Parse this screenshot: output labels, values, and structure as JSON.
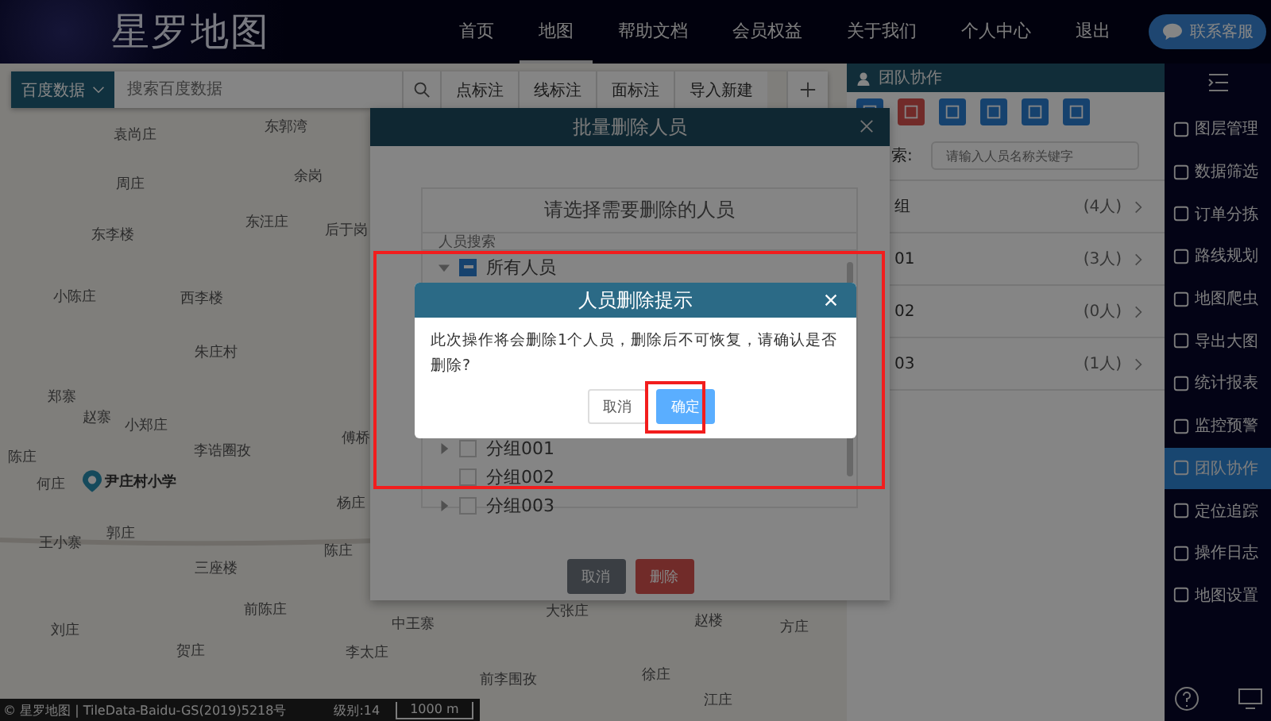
{
  "header": {
    "logo": "星罗地图",
    "nav": [
      {
        "label": "首页",
        "selected": false
      },
      {
        "label": "地图",
        "selected": true
      },
      {
        "label": "帮助文档",
        "selected": false
      },
      {
        "label": "会员权益",
        "selected": false
      },
      {
        "label": "关于我们",
        "selected": false
      },
      {
        "label": "个人中心",
        "selected": false
      },
      {
        "label": "退出",
        "selected": false
      }
    ],
    "contact_button": "联系客服"
  },
  "toolbar": {
    "source": "百度数据",
    "search": {
      "placeholder": "搜索百度数据"
    },
    "tools": [
      "点标注",
      "线标注",
      "面标注",
      "导入新建"
    ]
  },
  "map": {
    "labels": [
      "袁尚庄",
      "东郭湾",
      "周庄",
      "余岗",
      "东汪庄",
      "后于岗",
      "东李楼",
      "小陈庄",
      "西李楼",
      "朱庄村",
      "郑寨",
      "赵寨",
      "小郑庄",
      "李诰圈孜",
      "傅桥",
      "陈庄",
      "何庄",
      "杨庄",
      "郭庄",
      "王小寨",
      "陈庄",
      "三座楼",
      "前陈庄",
      "刘庄",
      "贺庄",
      "大张庄",
      "中王寨",
      "李太庄",
      "赵楼",
      "方庄",
      "徐庄",
      "前李围孜",
      "江庄"
    ],
    "poi": "尹庄村小学"
  },
  "status_bar": {
    "attribution": "© 星罗地图 | TileData-Baidu-GS(2019)5218号",
    "zoom_level": "级别:14",
    "scale": "1000 m"
  },
  "team_panel": {
    "title": "团队协作",
    "search_label": "索:",
    "search": {
      "placeholder": "请输入人员名称关键字"
    },
    "groups": [
      {
        "name": "组",
        "count": "(4人)"
      },
      {
        "name": "01",
        "count": "(3人)"
      },
      {
        "name": "02",
        "count": "(0人)"
      },
      {
        "name": "03",
        "count": "(1人)"
      }
    ]
  },
  "sidebar": {
    "items": [
      {
        "label": "图层管理",
        "selected": false
      },
      {
        "label": "数据筛选",
        "selected": false
      },
      {
        "label": "订单分拣",
        "selected": false
      },
      {
        "label": "路线规划",
        "selected": false
      },
      {
        "label": "地图爬虫",
        "selected": false
      },
      {
        "label": "导出大图",
        "selected": false
      },
      {
        "label": "统计报表",
        "selected": false
      },
      {
        "label": "监控预警",
        "selected": false
      },
      {
        "label": "团队协作",
        "selected": true
      },
      {
        "label": "定位追踪",
        "selected": false
      },
      {
        "label": "操作日志",
        "selected": false
      },
      {
        "label": "地图设置",
        "selected": false
      }
    ]
  },
  "batch_dialog": {
    "title": "批量删除人员",
    "heading": "请选择需要删除的人员",
    "search": {
      "placeholder": "人员搜索"
    },
    "tree": [
      {
        "label": "所有人员",
        "indeterminate": true,
        "expanded": true,
        "children": [
          {
            "label": "分组001",
            "checked": false,
            "expanded": false
          },
          {
            "label": "分组002",
            "checked": false
          },
          {
            "label": "分组003",
            "checked": false,
            "expanded": false
          }
        ]
      }
    ],
    "buttons": [
      {
        "label": "取消",
        "kind": "cancel"
      },
      {
        "label": "删除",
        "kind": "danger"
      }
    ]
  },
  "confirm_dialog": {
    "title": "人员删除提示",
    "message": "此次操作将会删除1个人员，删除后不可恢复，请确认是否删除?",
    "buttons": [
      {
        "label": "取消",
        "kind": "default"
      },
      {
        "label": "确定",
        "kind": "primary"
      }
    ]
  }
}
